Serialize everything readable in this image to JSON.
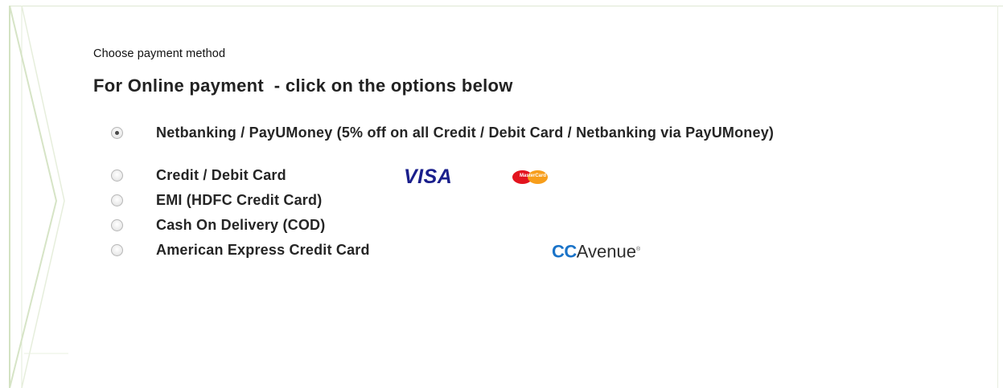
{
  "section": {
    "subtitle": "Choose payment method",
    "heading": "For Online payment  - click on the options below"
  },
  "payment_options": [
    {
      "label": "Netbanking / PayUMoney (5% off on all Credit / Debit Card / Netbanking via PayUMoney)",
      "selected": true
    },
    {
      "label": "Credit / Debit Card",
      "selected": false,
      "logos": [
        "visa-logo",
        "mastercard-logo"
      ]
    },
    {
      "label": "EMI (HDFC Credit Card)",
      "selected": false
    },
    {
      "label": "Cash On Delivery (COD)",
      "selected": false
    },
    {
      "label": "American Express Credit Card",
      "selected": false,
      "logos": [
        "ccavenue-logo"
      ]
    }
  ],
  "logos": {
    "visa": "VISA",
    "mastercard": "MasterCard",
    "ccavenue_cc": "CC",
    "ccavenue_rest": "Avenue",
    "ccavenue_mark": "®"
  },
  "colors": {
    "frame_green": "#cfe0bd",
    "visa_blue": "#1a1f8c",
    "ccavenue_blue": "#1a73c8",
    "mastercard_red": "#e3141e",
    "mastercard_orange": "#f79e1b"
  }
}
